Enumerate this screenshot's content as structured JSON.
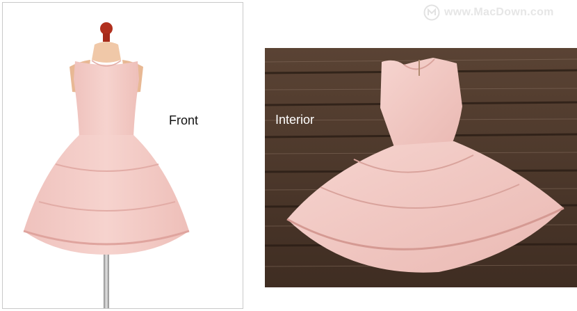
{
  "labels": {
    "front": "Front",
    "interior": "Interior"
  },
  "watermark": {
    "text": "www.MacDown.com",
    "icon": "macdown-logo-icon"
  },
  "colors": {
    "dress_pink": "#f2c9c4",
    "wood_dark": "#4a3528",
    "wood_light": "#7a6354",
    "mannequin_skin": "#f0c8a8",
    "finial": "#b1301e"
  }
}
